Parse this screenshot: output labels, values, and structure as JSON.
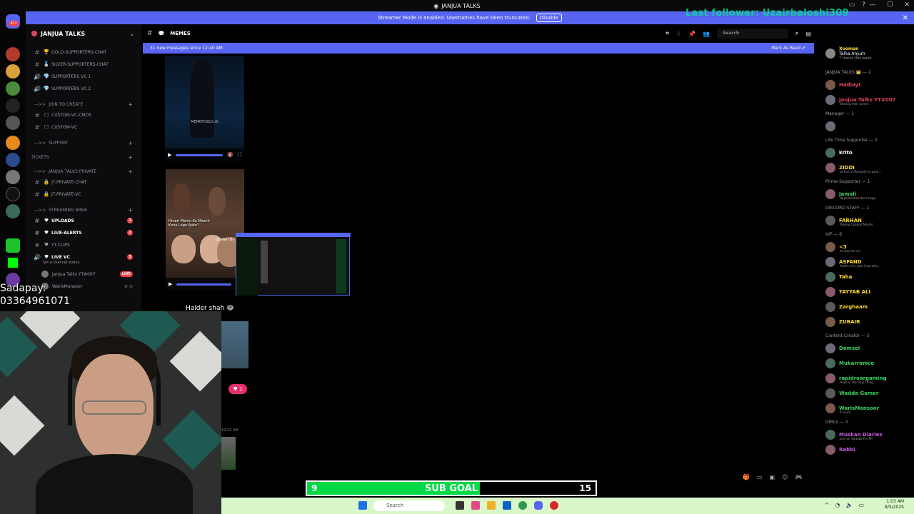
{
  "titlebar": {
    "title": "JANJUA TALKS",
    "window_controls": [
      "—",
      "☐",
      "✕"
    ]
  },
  "banner": {
    "text": "Streamer Mode is enabled. Usernames have been truncated.",
    "button": "Disable",
    "close": "✕"
  },
  "overlay": {
    "last_follower": "Last follower: Uzairbaloshi309",
    "sadapay_label": "Sadapay:",
    "sadapay_number": "03364961071"
  },
  "server": {
    "name": "JANJUA TALKS"
  },
  "channels": [
    {
      "name": "GOLD-SUPPORTERS-CHAT",
      "kind": "text"
    },
    {
      "name": "SILVER-SUPPORTERS-CHAT",
      "kind": "text"
    },
    {
      "name": "SUPPORTERS VC 1",
      "kind": "voice"
    },
    {
      "name": "SUPPORTERS VC 2",
      "kind": "voice"
    },
    {
      "name": "JOIN TO CREATE",
      "kind": "category"
    },
    {
      "name": "CUSTOM-VC-CMDS",
      "kind": "text"
    },
    {
      "name": "CUSTOM-VC",
      "kind": "text"
    },
    {
      "name": "SUPPORT",
      "kind": "category"
    },
    {
      "name": "TICKETS",
      "kind": "category"
    },
    {
      "name": "JANJUA TALKS PRIVATE",
      "kind": "category"
    },
    {
      "name": "JT-PRIVATE-CHAT",
      "kind": "text"
    },
    {
      "name": "JT-PRIVATE-VC",
      "kind": "text"
    },
    {
      "name": "STREAMING AREA",
      "kind": "category"
    },
    {
      "name": "UPLOADS",
      "kind": "text",
      "badge": "2"
    },
    {
      "name": "LIVE-ALERTS",
      "kind": "text",
      "badge": "2"
    },
    {
      "name": "YT-CLIPS",
      "kind": "text"
    },
    {
      "name": "LIVE VC",
      "kind": "voice",
      "badge": "1"
    }
  ],
  "live_vc": {
    "status_hint": "Set a channel status",
    "users": [
      {
        "name": "Janjua Talks YT#007",
        "live": "LIVE"
      },
      {
        "name": "WarisMansoor"
      }
    ]
  },
  "chat": {
    "channel_name": "MEMES",
    "search_placeholder": "Search",
    "new_messages": "31 new messages since 12:40 AM",
    "mark_as_read": "Mark As Read",
    "video1_watermark": "MEMEPIXELS.AI",
    "video2_caption": "Hmari Mamu Ko Maach Kona Lage Apko?",
    "video2_caption_2": "Or Meri Bv K",
    "message_text": "Haider shah 😂",
    "reel_likes": "1",
    "timestamp": "12:52 AM"
  },
  "members": {
    "top_activity": {
      "name": "Xooman",
      "sub": "Talha Anjum",
      "note": "7 tracks this week"
    },
    "groups": [
      {
        "label": "JANJUA TALKS 👑 — 2",
        "members": [
          {
            "name": "Hadiayt",
            "color": "#e0445a",
            "status": ""
          },
          {
            "name": "Janjua Talks YT#007",
            "color": "#e0445a",
            "status": "Sharing their screen"
          }
        ]
      },
      {
        "label": "Manager — 1",
        "members": [
          {
            "name": "",
            "color": "#444",
            "status": ""
          }
        ]
      },
      {
        "label": "Life Time Supporter — 2",
        "members": [
          {
            "name": "krito",
            "color": "#ffffff",
            "status": ""
          },
          {
            "name": "ZIDDI",
            "color": "#ffdd33",
            "status": "ye kon ai Phenyelo ka pack..."
          }
        ]
      },
      {
        "label": "Prime Supporter — 1",
        "members": [
          {
            "name": "Jamali",
            "color": "#3cd15f",
            "status": "Opportunities don't happ..."
          }
        ]
      },
      {
        "label": "DISCORD STAFF — 1",
        "members": [
          {
            "name": "FARHAN",
            "color": "#ffdd33",
            "status": "Playing Combat Master"
          }
        ]
      },
      {
        "label": "VIP — 6",
        "members": [
          {
            "name": "<3",
            "color": "#ffdd33",
            "status": "he was her sin"
          },
          {
            "name": "ASFAND",
            "color": "#ffdd33",
            "status": "Austin: It is your I just who..."
          },
          {
            "name": "Taha",
            "color": "#ffdd33",
            "status": ""
          },
          {
            "name": "TAYYAB ALI",
            "color": "#ffdd33",
            "status": ""
          },
          {
            "name": "Zarghaam",
            "color": "#ffdd33",
            "status": ""
          },
          {
            "name": "ZUBAIR",
            "color": "#ffdd33",
            "status": ""
          }
        ]
      },
      {
        "label": "Content Creator — 5",
        "members": [
          {
            "name": "Damsel",
            "color": "#3cd15f",
            "status": ""
          },
          {
            "name": "Mukarramco",
            "color": "#3cd15f",
            "status": ""
          },
          {
            "name": "rapidroargaming",
            "color": "#3cd15f",
            "status": "Hope is The Only Thing..."
          },
          {
            "name": "Wadda Gamer",
            "color": "#3cd15f",
            "status": ""
          },
          {
            "name": "WarisMansoor",
            "color": "#3cd15f",
            "status": "In voice"
          }
        ]
      },
      {
        "label": "GIRLS — 3",
        "members": [
          {
            "name": "Muskan Diaries",
            "color": "#c45de0",
            "status": "Live on Youtube For RP"
          },
          {
            "name": "Rabbi",
            "color": "#c45de0",
            "status": ""
          }
        ]
      }
    ]
  },
  "sub_goal": {
    "current": "9",
    "label": "SUB GOAL",
    "target": "15",
    "progress": 0.6
  },
  "taskbar": {
    "search": "Search",
    "time": "1:03 AM",
    "date": "8/5/2025"
  },
  "colors": {
    "accent": "#5865f2",
    "sub_goal_fill": "#00d846",
    "taskbar": "#d9f7c8"
  }
}
